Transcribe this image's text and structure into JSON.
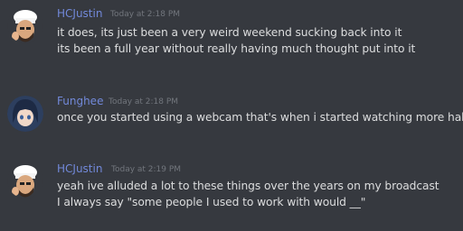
{
  "colors": {
    "background": "#36393f",
    "username": "#7289da",
    "timestamp": "#72767d",
    "text": "#dcddde"
  },
  "messages": [
    {
      "username": "HCJustin",
      "timestamp": "Today at 2:18 PM",
      "avatar": "chef-avatar",
      "lines": [
        "it does, its just been a very weird weekend sucking back into it",
        "its been a full year without really having much thought put into it"
      ]
    },
    {
      "username": "Funghee",
      "timestamp": "Today at 2:18 PM",
      "avatar": "anime-avatar",
      "lines": [
        "once you started using a webcam that's when i started watching more haha,"
      ]
    },
    {
      "username": "HCJustin",
      "timestamp": "Today at 2:19 PM",
      "avatar": "chef-avatar",
      "lines": [
        "yeah ive alluded a lot to these things over the years on my broadcast",
        "I always say \"some people I used to work with would __\""
      ]
    }
  ]
}
